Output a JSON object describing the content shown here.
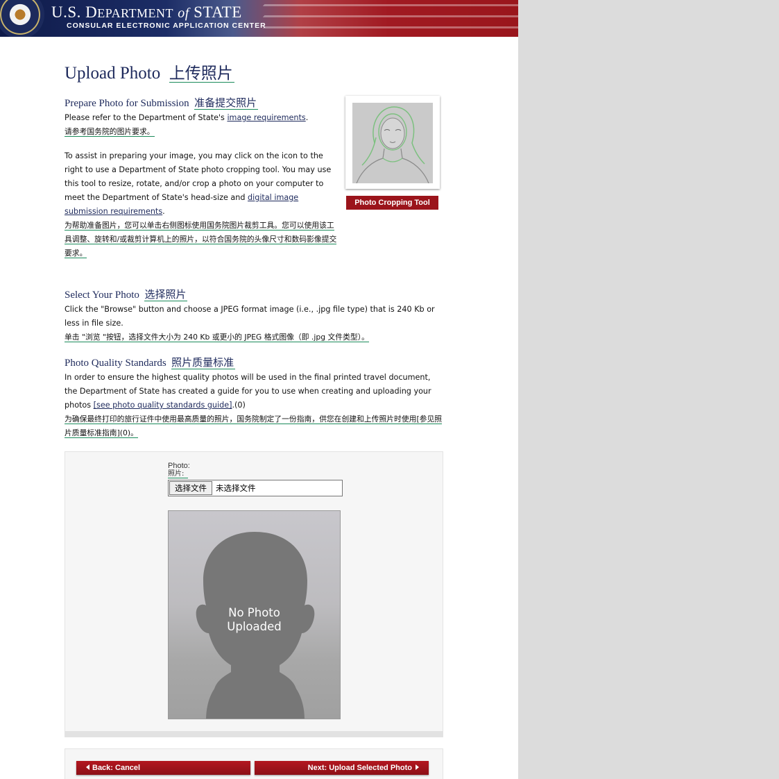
{
  "header": {
    "title_us": "U.S. D",
    "title_dept": "EPARTMENT",
    "title_of": "of",
    "title_state": "STATE",
    "subtitle": "CONSULAR ELECTRONIC APPLICATION CENTER",
    "seal_icon": "us-department-of-state-seal"
  },
  "page": {
    "title_en": "Upload Photo",
    "title_zh": "上传照片"
  },
  "prepare": {
    "title_en": "Prepare Photo for Submission",
    "title_zh": "准备提交照片",
    "refer_prefix": "Please refer to the Department of State's ",
    "refer_link": "image requirements",
    "refer_suffix": ".",
    "refer_zh": "请参考国务院的图片要求。",
    "assist_text": "To assist in preparing your image, you may click on the icon to the right to use a Department of State photo cropping tool. You may use this tool to resize, rotate, and/or crop a photo on your computer to meet the Department of State's head-size and ",
    "assist_link": "digital image submission requirements",
    "assist_suffix": ".",
    "assist_zh": "为帮助准备图片，您可以单击右侧图标使用国务院图片裁剪工具。您可以使用该工具调整、旋转和/或裁剪计算机上的照片，以符合国务院的头像尺寸和数码影像提交要求。",
    "crop_button": "Photo Cropping Tool"
  },
  "select": {
    "title_en": "Select Your Photo",
    "title_zh": "选择照片",
    "text": "Click the \"Browse\" button and choose a JPEG format image (i.e., .jpg file type) that is 240 Kb or less in file size.",
    "text_zh": "单击 \"浏览 \"按钮，选择文件大小为 240 Kb 或更小的 JPEG 格式图像（即 .jpg 文件类型）。"
  },
  "quality": {
    "title_en": "Photo Quality Standards",
    "title_zh": "照片质量标准",
    "text": "In order to ensure the highest quality photos will be used in the final printed travel document, the Department of State has created a guide for you to use when creating and uploading your photos ",
    "link": "[see photo quality standards guide]",
    "suffix": ".(0)",
    "text_zh": "为确保最终打印的旅行证件中使用最高质量的照片，国务院制定了一份指南，供您在创建和上传照片时使用[参见照片质量标准指南](0)。"
  },
  "upload": {
    "label_en": "Photo:",
    "label_zh": "照片:",
    "file_button": "选择文件",
    "file_status": "未选择文件",
    "placeholder_text": "No Photo\nUploaded"
  },
  "nav": {
    "back": "Back: Cancel",
    "next": "Next: Upload Selected Photo"
  }
}
